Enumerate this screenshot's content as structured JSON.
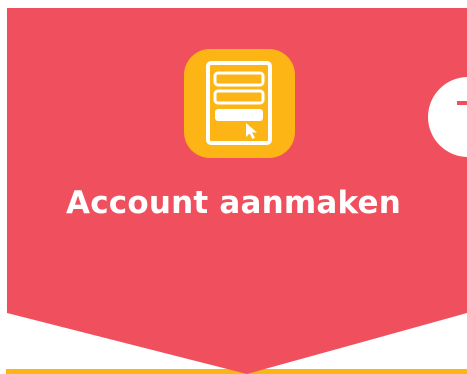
{
  "step": {
    "title": "Account aanmaken",
    "icon": "signup-form-icon"
  },
  "next_step": {
    "icon": "next-step-indicator-icon"
  },
  "colors": {
    "banner": "#f04f5e",
    "icon_background": "#fdb515",
    "icon_foreground": "#ffffff",
    "accent_line": "#fdb515",
    "background": "#ffffff"
  }
}
